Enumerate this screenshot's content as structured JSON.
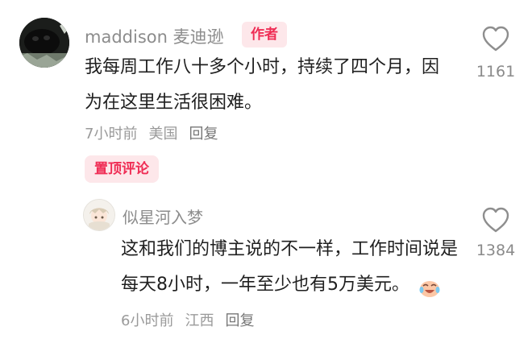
{
  "main_comment": {
    "username": "maddison 麦迪逊",
    "author_badge": "作者",
    "text": "我每周工作八十多个小时，持续了四个月，因为在这里生活很困难。",
    "time": "7小时前",
    "location": "美国",
    "reply_label": "回复",
    "like_count": "1161",
    "pinned_label": "置顶评论"
  },
  "reply_comment": {
    "username": "似星河入梦",
    "text": "这和我们的博主说的不一样，工作时间说是每天8小时，一年至少也有5万美元。",
    "time": "6小时前",
    "location": "江西",
    "reply_label": "回复",
    "like_count": "1384"
  },
  "colors": {
    "badge_text": "#ef2d55",
    "badge_bg": "#fde7ea",
    "meta_text": "#9a9a9a"
  }
}
